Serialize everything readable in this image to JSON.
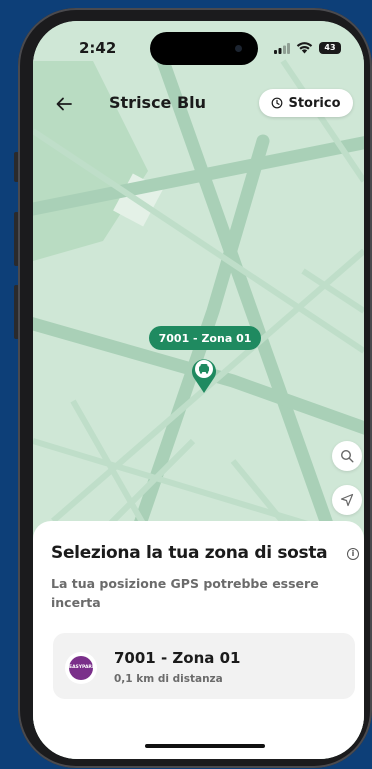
{
  "status_bar": {
    "time": "2:42",
    "battery": "43"
  },
  "header": {
    "title": "Strisce Blu",
    "history_label": "Storico",
    "icons": {
      "back": "arrow-left-icon",
      "history": "clock-icon"
    }
  },
  "map": {
    "zone_tag": "7001 - Zona 01",
    "pin_icon": "car-marker-icon",
    "search_icon": "search-icon",
    "locate_icon": "location-arrow-icon",
    "accent_color": "#1f8a60"
  },
  "sheet": {
    "title": "Seleziona la tua zona di sosta",
    "subtitle": "La tua posizione GPS potrebbe essere incerta",
    "zone": {
      "name": "7001 - Zona 01",
      "distance": "0,1 km di distanza",
      "logo_text": "EASYPARK"
    }
  }
}
